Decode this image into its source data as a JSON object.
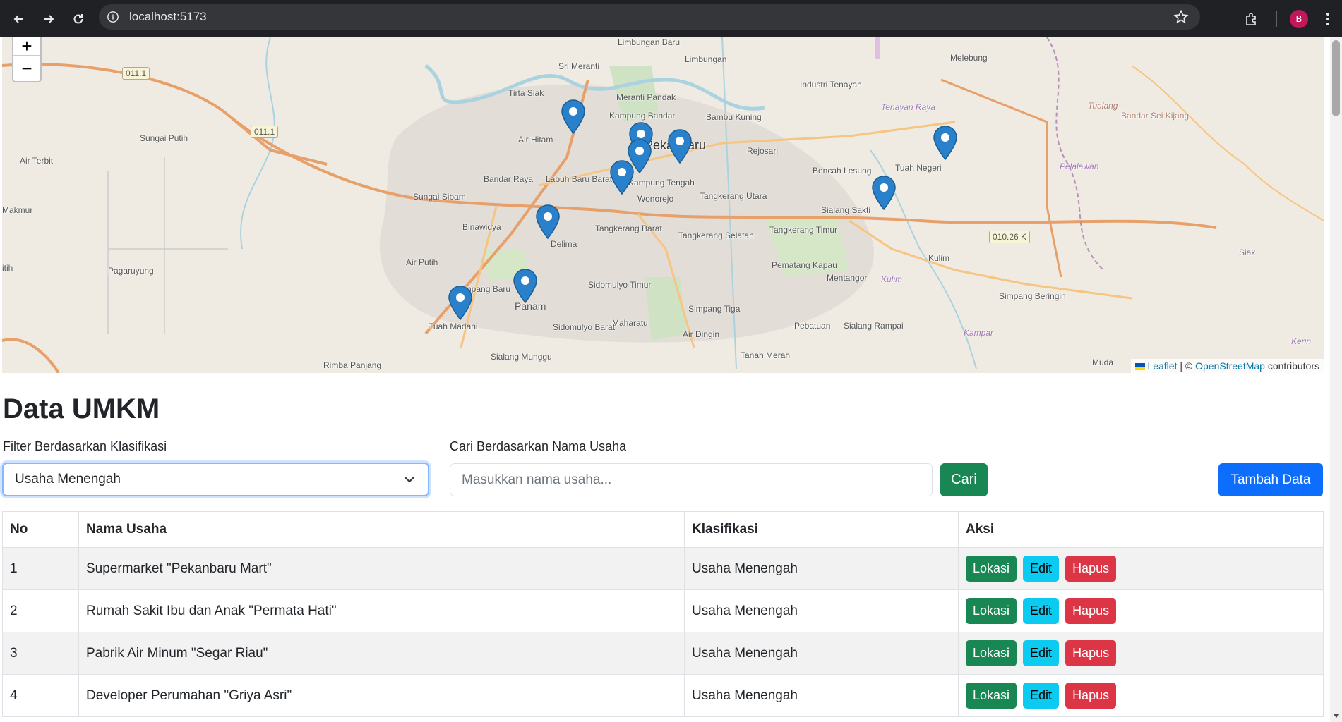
{
  "browser": {
    "url": "localhost:5173",
    "avatar_letter": "B"
  },
  "map": {
    "zoom_in": "+",
    "zoom_out": "−",
    "places": [
      {
        "name": "Limbungan Baru"
      },
      {
        "name": "Limbungan"
      },
      {
        "name": "Sri Meranti"
      },
      {
        "name": "Melebung"
      },
      {
        "name": "Industri Tenayan"
      },
      {
        "name": "Tirta Siak"
      },
      {
        "name": "Meranti Pandak"
      },
      {
        "name": "Kampung Bandar"
      },
      {
        "name": "Bambu Kuning"
      },
      {
        "name": "Sungai Putih"
      },
      {
        "name": "Air Hitam"
      },
      {
        "name": "Pekanbaru"
      },
      {
        "name": "Rejosari"
      },
      {
        "name": "Tenayan Raya"
      },
      {
        "name": "Tuah Negeri"
      },
      {
        "name": "Bandar Sei Kijang"
      },
      {
        "name": "Air Terbit"
      },
      {
        "name": "Bandar Raya"
      },
      {
        "name": "Labuh Baru Barat"
      },
      {
        "name": "Kampung Tengah"
      },
      {
        "name": "Bencah Lesung"
      },
      {
        "name": "Sungai Sibam"
      },
      {
        "name": "Wonorejo"
      },
      {
        "name": "Tangkerang Utara"
      },
      {
        "name": "Sialang Sakti"
      },
      {
        "name": "Makmur"
      },
      {
        "name": "Binawidya"
      },
      {
        "name": "Tangkerang Barat"
      },
      {
        "name": "Tangkerang Selatan"
      },
      {
        "name": "Tangkerang Timur"
      },
      {
        "name": "Delima"
      },
      {
        "name": "Air Putih"
      },
      {
        "name": "Kulim"
      },
      {
        "name": "Pagaruyung"
      },
      {
        "name": "Sidomulyo Timur"
      },
      {
        "name": "Pematang Kapau"
      },
      {
        "name": "Mentangor"
      },
      {
        "name": "Simpang Baru"
      },
      {
        "name": "Panam"
      },
      {
        "name": "Simpang Beringin"
      },
      {
        "name": "Simpang Tiga"
      },
      {
        "name": "Maharatu"
      },
      {
        "name": "Tuah Madani"
      },
      {
        "name": "Sidomulyo Barat"
      },
      {
        "name": "Pebatuan"
      },
      {
        "name": "Sialang Rampai"
      },
      {
        "name": "Air Dingin"
      },
      {
        "name": "Sialang Munggu"
      },
      {
        "name": "Tanah Merah"
      },
      {
        "name": "Rimba Panjang"
      },
      {
        "name": "Muda"
      },
      {
        "name": "Tualang"
      },
      {
        "name": "Kampar"
      },
      {
        "name": "Siak"
      },
      {
        "name": "Kulim"
      },
      {
        "name": "Pelalawan"
      },
      {
        "name": "Kerin"
      },
      {
        "name": "itih"
      }
    ],
    "road_shields": [
      "011.1",
      "011.1",
      "010.26 K"
    ],
    "attribution": {
      "leaflet": "Leaflet",
      "sep": " | © ",
      "osm": "OpenStreetMap",
      "contributors": " contributors"
    }
  },
  "page": {
    "title": "Data UMKM",
    "filter_label": "Filter Berdasarkan Klasifikasi",
    "filter_value": "Usaha Menengah",
    "search_label": "Cari Berdasarkan Nama Usaha",
    "search_placeholder": "Masukkan nama usaha...",
    "search_button": "Cari",
    "add_button": "Tambah Data"
  },
  "table": {
    "headers": [
      "No",
      "Nama Usaha",
      "Klasifikasi",
      "Aksi"
    ],
    "rows": [
      {
        "no": "1",
        "nama": "Supermarket \"Pekanbaru Mart\"",
        "klasifikasi": "Usaha Menengah"
      },
      {
        "no": "2",
        "nama": "Rumah Sakit Ibu dan Anak \"Permata Hati\"",
        "klasifikasi": "Usaha Menengah"
      },
      {
        "no": "3",
        "nama": "Pabrik Air Minum \"Segar Riau\"",
        "klasifikasi": "Usaha Menengah"
      },
      {
        "no": "4",
        "nama": "Developer Perumahan \"Griya Asri\"",
        "klasifikasi": "Usaha Menengah"
      }
    ],
    "actions": {
      "lokasi": "Lokasi",
      "edit": "Edit",
      "hapus": "Hapus"
    }
  },
  "colors": {
    "marker": "#2a81cb",
    "success": "#198754",
    "primary": "#0d6efd",
    "info": "#0dcaf0",
    "danger": "#dc3545"
  }
}
